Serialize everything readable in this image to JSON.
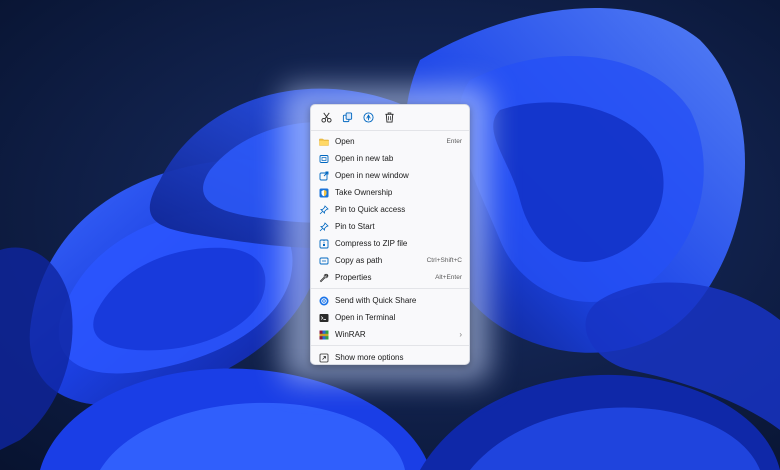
{
  "quick_actions": [
    {
      "name": "cut-icon",
      "label": "Cut"
    },
    {
      "name": "copy-icon",
      "label": "Copy"
    },
    {
      "name": "share-icon",
      "label": "Share"
    },
    {
      "name": "delete-icon",
      "label": "Delete"
    }
  ],
  "menu": {
    "group1": [
      {
        "label": "Open",
        "shortcut": "Enter",
        "icon": "folder-icon"
      },
      {
        "label": "Open in new tab",
        "shortcut": "",
        "icon": "new-tab-icon"
      },
      {
        "label": "Open in new window",
        "shortcut": "",
        "icon": "new-window-icon"
      },
      {
        "label": "Take Ownership",
        "shortcut": "",
        "icon": "shield-icon"
      },
      {
        "label": "Pin to Quick access",
        "shortcut": "",
        "icon": "pin-icon"
      },
      {
        "label": "Pin to Start",
        "shortcut": "",
        "icon": "pin-icon"
      },
      {
        "label": "Compress to ZIP file",
        "shortcut": "",
        "icon": "zip-icon"
      },
      {
        "label": "Copy as path",
        "shortcut": "Ctrl+Shift+C",
        "icon": "path-icon"
      },
      {
        "label": "Properties",
        "shortcut": "Alt+Enter",
        "icon": "wrench-icon"
      }
    ],
    "group2": [
      {
        "label": "Send with Quick Share",
        "shortcut": "",
        "icon": "quick-share-icon"
      },
      {
        "label": "Open in Terminal",
        "shortcut": "",
        "icon": "terminal-icon"
      },
      {
        "label": "WinRAR",
        "shortcut": "",
        "icon": "winrar-icon",
        "submenu": "›"
      }
    ],
    "group3": [
      {
        "label": "Show more options",
        "shortcut": "",
        "icon": "more-options-icon"
      }
    ]
  },
  "colors": {
    "accent": "#0067c0",
    "wallpaper_dark": "#0a1a3d",
    "wallpaper_blue": "#1a3cf0",
    "menu_bg": "#f9f9fb"
  }
}
